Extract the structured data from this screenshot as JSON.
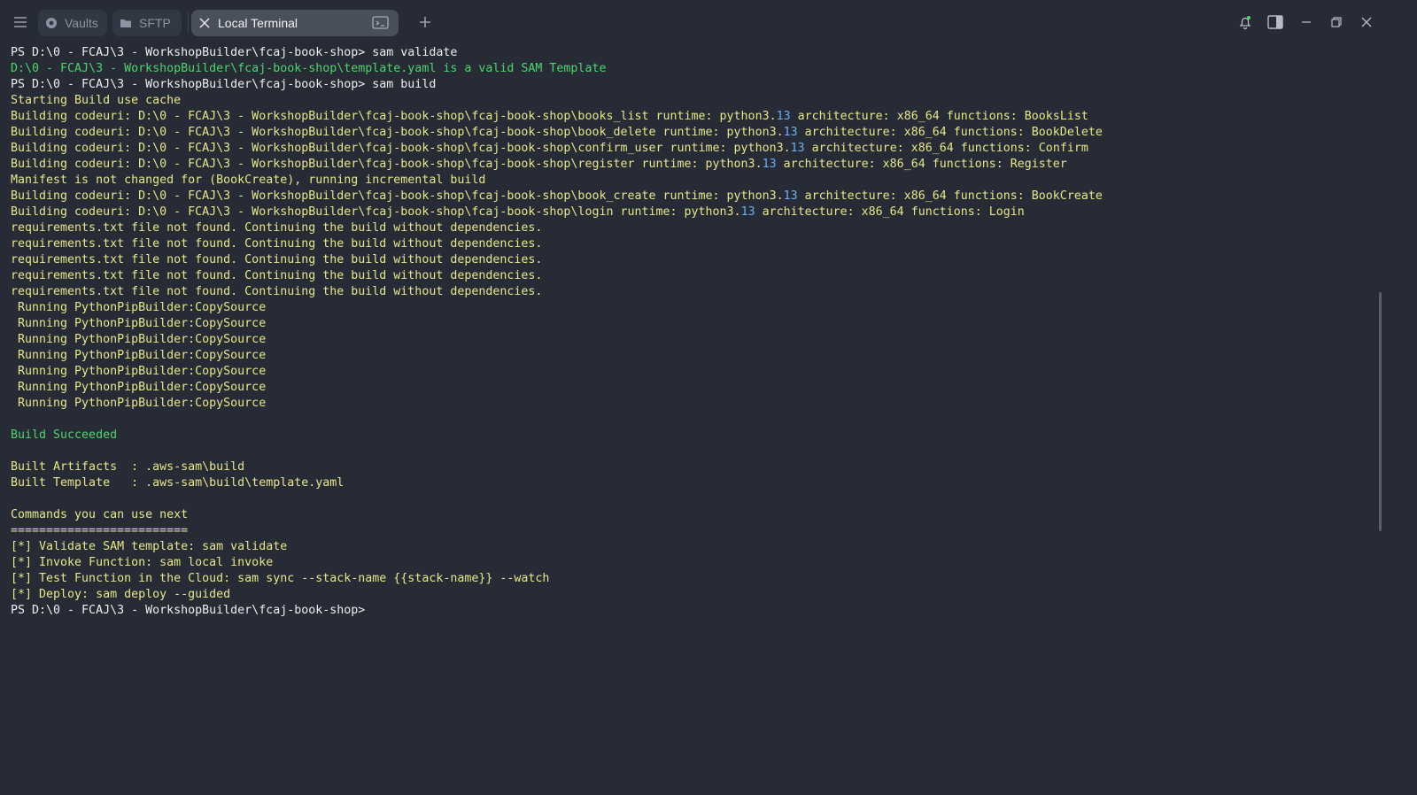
{
  "tabs": [
    {
      "label": "Vaults",
      "icon": "vault-icon",
      "active": false
    },
    {
      "label": "SFTP",
      "icon": "folder-icon",
      "active": false
    },
    {
      "label": "Local Terminal",
      "icon": "close-icon",
      "active": true
    }
  ],
  "terminal": {
    "lines": [
      {
        "text": "PS D:\\0 - FCAJ\\3 - WorkshopBuilder\\fcaj-book-shop> sam validate",
        "style": "w"
      },
      {
        "text": "D:\\0 - FCAJ\\3 - WorkshopBuilder\\fcaj-book-shop\\template.yaml is a valid SAM Template",
        "style": "g"
      },
      {
        "text": "PS D:\\0 - FCAJ\\3 - WorkshopBuilder\\fcaj-book-shop> sam build",
        "style": "w"
      },
      {
        "text": "Starting Build use cache",
        "style": "y"
      },
      {
        "text": "Building codeuri: D:\\0 - FCAJ\\3 - WorkshopBuilder\\fcaj-book-shop\\fcaj-book-shop\\books_list runtime: python3.13 architecture: x86_64 functions: BooksList",
        "style": "y"
      },
      {
        "text": "Building codeuri: D:\\0 - FCAJ\\3 - WorkshopBuilder\\fcaj-book-shop\\fcaj-book-shop\\book_delete runtime: python3.13 architecture: x86_64 functions: BookDelete",
        "style": "y"
      },
      {
        "text": "Building codeuri: D:\\0 - FCAJ\\3 - WorkshopBuilder\\fcaj-book-shop\\fcaj-book-shop\\confirm_user runtime: python3.13 architecture: x86_64 functions: Confirm",
        "style": "y"
      },
      {
        "text": "Building codeuri: D:\\0 - FCAJ\\3 - WorkshopBuilder\\fcaj-book-shop\\fcaj-book-shop\\register runtime: python3.13 architecture: x86_64 functions: Register",
        "style": "y"
      },
      {
        "text": "Manifest is not changed for (BookCreate), running incremental build",
        "style": "y"
      },
      {
        "text": "Building codeuri: D:\\0 - FCAJ\\3 - WorkshopBuilder\\fcaj-book-shop\\fcaj-book-shop\\book_create runtime: python3.13 architecture: x86_64 functions: BookCreate",
        "style": "y"
      },
      {
        "text": "Building codeuri: D:\\0 - FCAJ\\3 - WorkshopBuilder\\fcaj-book-shop\\fcaj-book-shop\\login runtime: python3.13 architecture: x86_64 functions: Login",
        "style": "y"
      },
      {
        "text": "requirements.txt file not found. Continuing the build without dependencies.",
        "style": "y"
      },
      {
        "text": "requirements.txt file not found. Continuing the build without dependencies.",
        "style": "y"
      },
      {
        "text": "requirements.txt file not found. Continuing the build without dependencies.",
        "style": "y"
      },
      {
        "text": "requirements.txt file not found. Continuing the build without dependencies.",
        "style": "y"
      },
      {
        "text": "requirements.txt file not found. Continuing the build without dependencies.",
        "style": "y"
      },
      {
        "text": " Running PythonPipBuilder:CopySource",
        "style": "y"
      },
      {
        "text": " Running PythonPipBuilder:CopySource",
        "style": "y"
      },
      {
        "text": " Running PythonPipBuilder:CopySource",
        "style": "y"
      },
      {
        "text": " Running PythonPipBuilder:CopySource",
        "style": "y"
      },
      {
        "text": " Running PythonPipBuilder:CopySource",
        "style": "y"
      },
      {
        "text": " Running PythonPipBuilder:CopySource",
        "style": "y"
      },
      {
        "text": " Running PythonPipBuilder:CopySource",
        "style": "y"
      },
      {
        "text": "",
        "style": "y"
      },
      {
        "text": "Build Succeeded",
        "style": "g"
      },
      {
        "text": "",
        "style": "y"
      },
      {
        "text": "Built Artifacts  : .aws-sam\\build",
        "style": "y"
      },
      {
        "text": "Built Template   : .aws-sam\\build\\template.yaml",
        "style": "y"
      },
      {
        "text": "",
        "style": "y"
      },
      {
        "text": "Commands you can use next",
        "style": "y"
      },
      {
        "text": "=========================",
        "style": "y"
      },
      {
        "text": "[*] Validate SAM template: sam validate",
        "style": "y"
      },
      {
        "text": "[*] Invoke Function: sam local invoke",
        "style": "y"
      },
      {
        "text": "[*] Test Function in the Cloud: sam sync --stack-name {{stack-name}} --watch",
        "style": "y"
      },
      {
        "text": "[*] Deploy: sam deploy --guided",
        "style": "y"
      },
      {
        "text": "PS D:\\0 - FCAJ\\3 - WorkshopBuilder\\fcaj-book-shop>",
        "style": "w"
      }
    ]
  },
  "colors": {
    "background": "#272b36",
    "success_green": "#4ed46a",
    "output_yellow": "#e7e68a",
    "prompt_white": "#eeeeee",
    "version_blue": "#6aaff0"
  }
}
